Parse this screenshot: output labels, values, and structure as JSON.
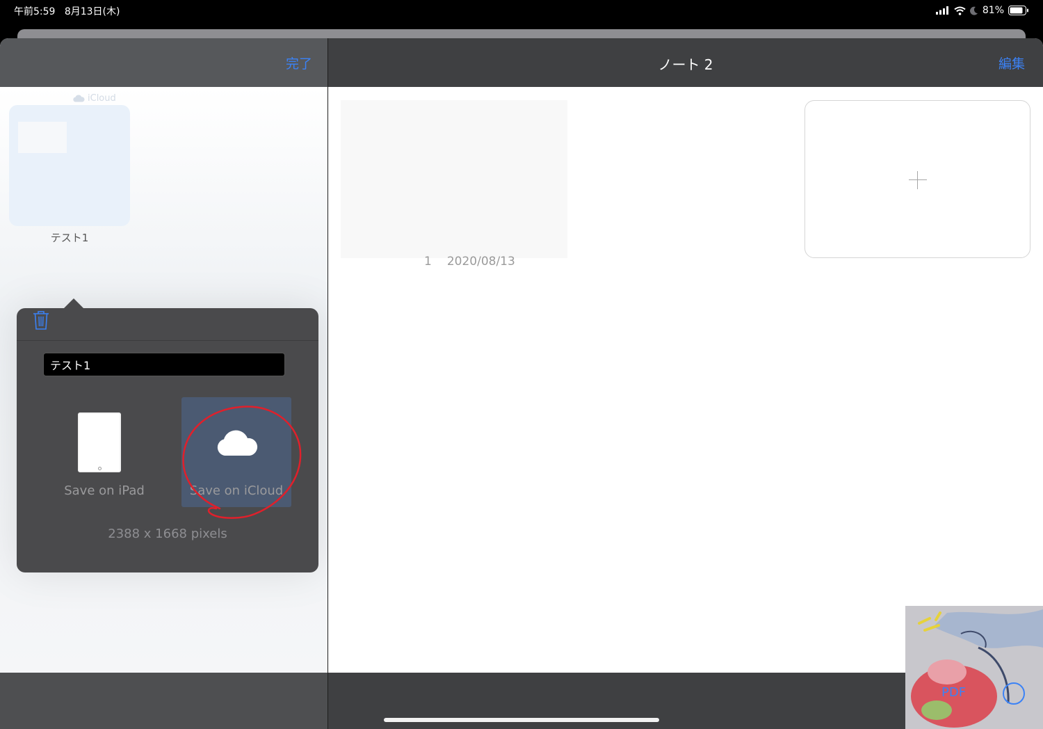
{
  "status_bar": {
    "time": "午前5:59",
    "date": "8月13日(木)",
    "battery": "81%"
  },
  "library": {
    "done_label": "完了",
    "cloud_label": "iCloud",
    "note_name": "テスト1"
  },
  "notebook": {
    "title": "ノート 2",
    "edit_label": "編集",
    "page_number": "1",
    "page_date": "2020/08/13"
  },
  "popover": {
    "name_value": "テスト1",
    "save_ipad_label": "Save on iPad",
    "save_icloud_label": "Save on iCloud",
    "pixels": "2388 x 1668 pixels"
  },
  "toolbar": {
    "pdf_label": "PDF"
  },
  "colors": {
    "accent": "#3b82f6",
    "annotation_red": "#e0202b"
  }
}
